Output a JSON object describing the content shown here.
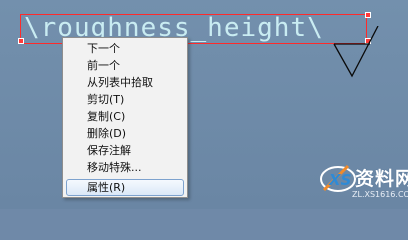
{
  "drawing": {
    "annotation_text": "\\roughness_height\\"
  },
  "context_menu": {
    "items": [
      {
        "label": "下一个",
        "name": "menu-item-next"
      },
      {
        "label": "前一个",
        "name": "menu-item-previous"
      },
      {
        "label": "从列表中拾取",
        "name": "menu-item-pick-from-list"
      },
      {
        "label": "剪切(T)",
        "name": "menu-item-cut"
      },
      {
        "label": "复制(C)",
        "name": "menu-item-copy"
      },
      {
        "label": "删除(D)",
        "name": "menu-item-delete"
      },
      {
        "label": "保存注解",
        "name": "menu-item-save-annotation"
      },
      {
        "label": "移动特殊...",
        "name": "menu-item-move-special"
      },
      {
        "label": "属性(R)",
        "name": "menu-item-properties"
      }
    ],
    "highlighted_item": "属性(R)"
  },
  "watermark": {
    "title": "资料网",
    "url": "ZL.XS1616.COM"
  },
  "colors": {
    "background": "#6f89a8",
    "annotation_text": "#c9ecf2",
    "selection_box": "#ff2a2a",
    "menu_background": "#f2f2f2",
    "menu_highlight_border": "#7da2ce"
  }
}
